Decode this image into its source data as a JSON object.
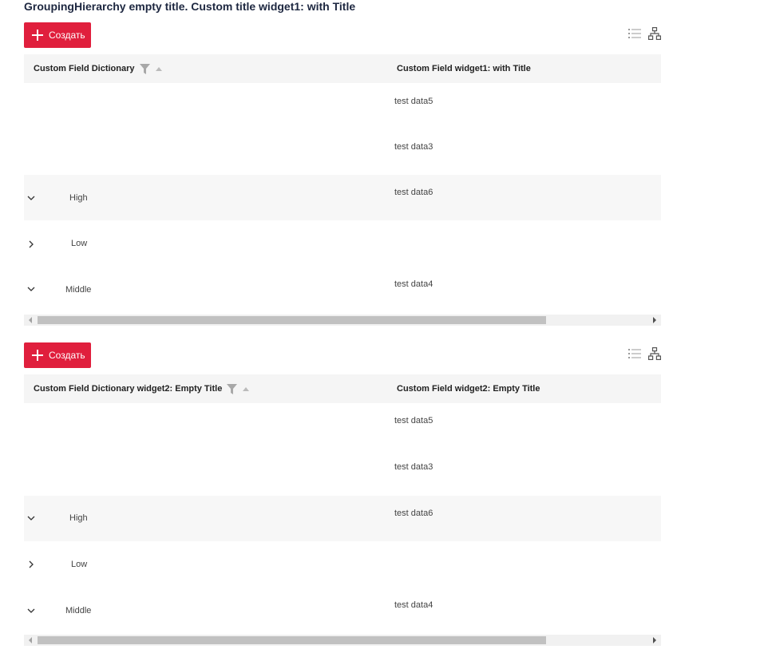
{
  "page": {
    "title": "GroupingHierarchy empty title. Custom title widget1: with Title"
  },
  "widgets": [
    {
      "create_label": "Создать",
      "columns": [
        "Custom Field Dictionary",
        "Custom Field widget1: with Title"
      ],
      "rows": [
        {
          "group": "",
          "value": "test data5",
          "expand": "none"
        },
        {
          "group": "",
          "value": "test data3",
          "expand": "none"
        },
        {
          "group": "High",
          "value": "test data6",
          "expand": "expanded"
        },
        {
          "group": "Low",
          "value": "",
          "expand": "collapsed"
        },
        {
          "group": "Middle",
          "value": "test data4",
          "expand": "expanded"
        }
      ],
      "scroll_fraction": 0.8
    },
    {
      "create_label": "Создать",
      "columns": [
        "Custom Field Dictionary widget2: Empty Title",
        "Custom Field widget2: Empty Title"
      ],
      "rows": [
        {
          "group": "",
          "value": "test data5",
          "expand": "none"
        },
        {
          "group": "",
          "value": "test data3",
          "expand": "none"
        },
        {
          "group": "High",
          "value": "test data6",
          "expand": "expanded"
        },
        {
          "group": "Low",
          "value": "",
          "expand": "collapsed"
        },
        {
          "group": "Middle",
          "value": "test data4",
          "expand": "expanded"
        }
      ],
      "scroll_fraction": 0.8
    }
  ],
  "icons": {
    "create": "plus-icon",
    "list_view": "list-view-icon",
    "hierarchy_view": "hierarchy-view-icon",
    "filter": "filter-icon",
    "sort": "sort-ascending-icon",
    "expanded": "chevron-down-icon",
    "collapsed": "chevron-right-icon"
  },
  "colors": {
    "accent": "#e01f3d",
    "header_bg": "#f5f5f5",
    "title": "#1d2740"
  }
}
